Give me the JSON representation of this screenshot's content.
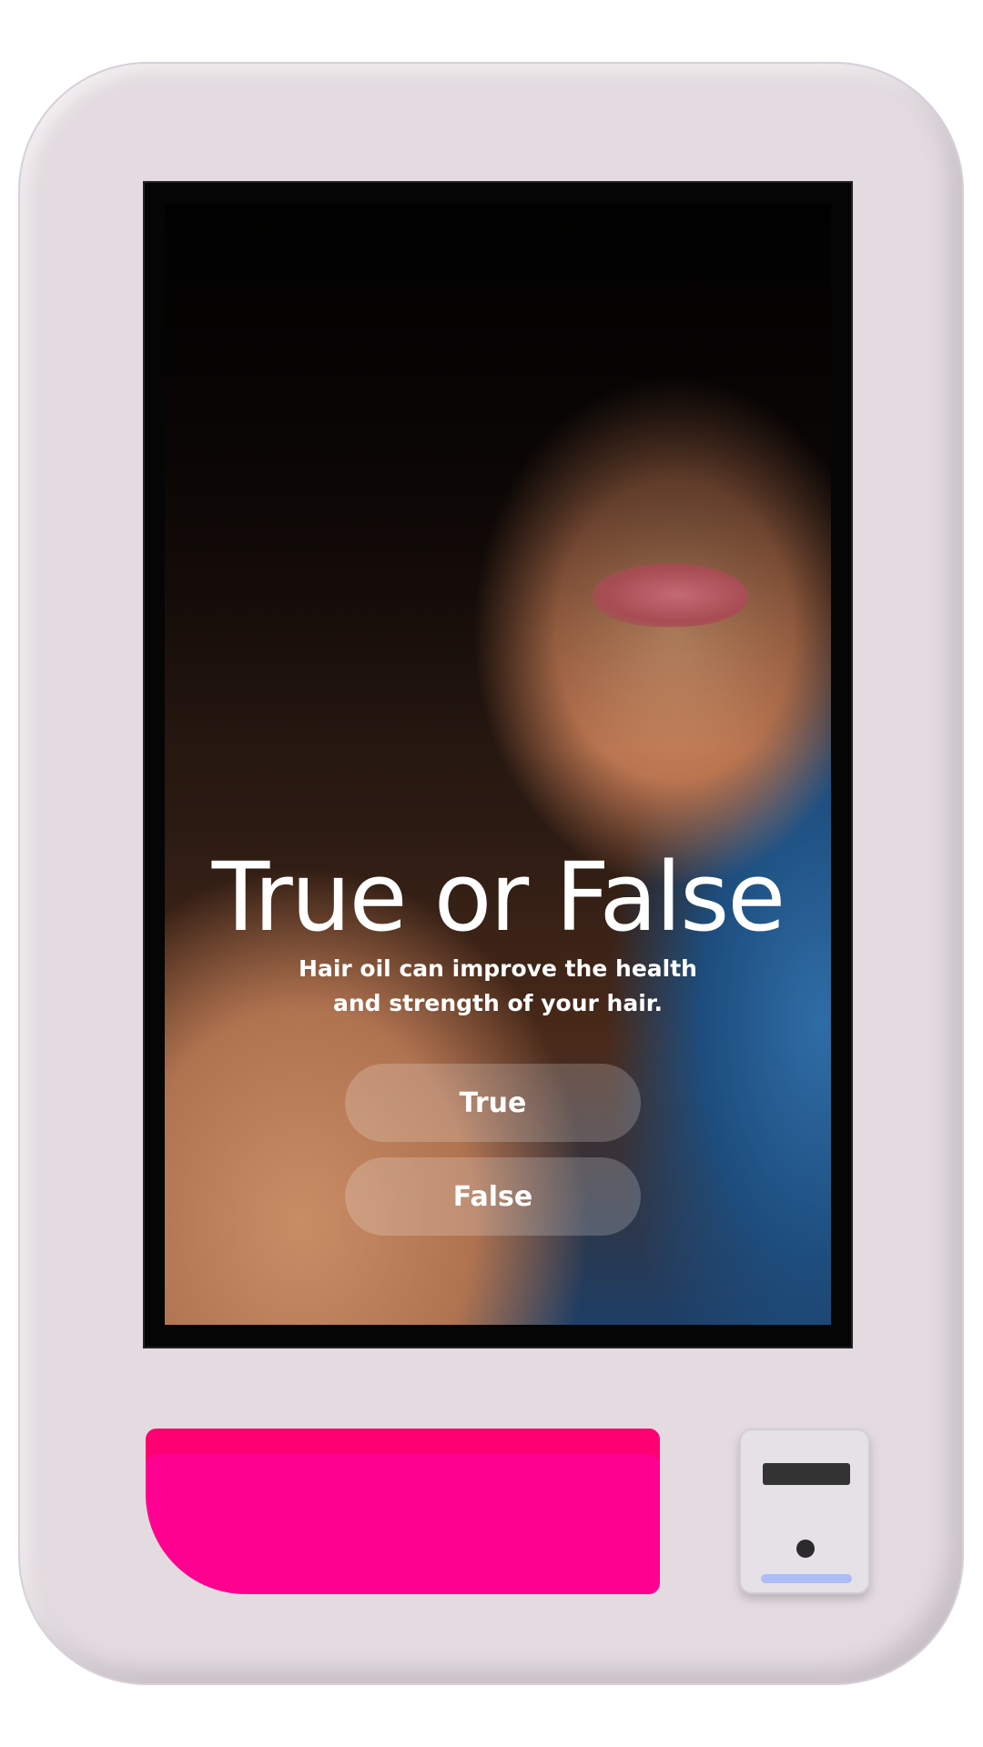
{
  "quiz": {
    "title": "True or False",
    "statement_line1": "Hair oil can improve the health",
    "statement_line2": "and strength of your hair.",
    "options": [
      {
        "label": "True"
      },
      {
        "label": "False"
      }
    ]
  },
  "colors": {
    "kiosk_body": "#e3dbdf",
    "card_slot": "#ff0090",
    "reader_indicator": "#aebcf5"
  }
}
